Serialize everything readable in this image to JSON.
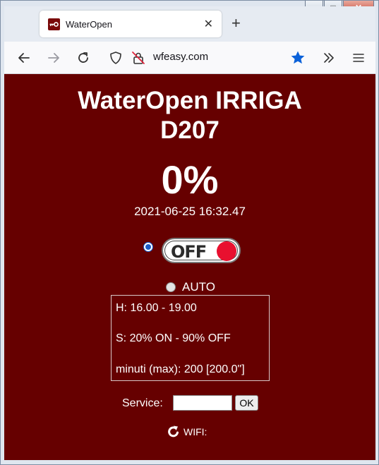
{
  "browser": {
    "tab_title": "WaterOpen",
    "url": "wfeasy.com",
    "window_controls": {
      "minimize": "–",
      "maximize": "□",
      "close": "✕"
    },
    "tab_close": "✕",
    "new_tab": "+"
  },
  "page": {
    "title_line1": "WaterOpen IRRIGA",
    "title_line2": "D207",
    "percent": "0%",
    "datetime": "2021-06-25 16:32.47",
    "toggle_label": "OFF",
    "manual_selected": true,
    "auto_label": "AUTO",
    "info": {
      "hours": "H: 16.00 - 19.00",
      "schedule": "S: 20% ON - 90% OFF",
      "minutes": "minuti (max): 200 [200.0\"]"
    },
    "service_label": "Service:",
    "service_value": "",
    "ok_label": "OK",
    "wifi_label": "WIFI:"
  },
  "colors": {
    "background": "#660000",
    "toggle_knob": "#e8102f",
    "bookmark_star": "#0a61d9"
  },
  "icons": {
    "back": "arrow-left-icon",
    "forward": "arrow-right-icon",
    "reload": "reload-icon",
    "shield": "shield-icon",
    "insecure": "insecure-lock-icon",
    "bookmark": "star-icon",
    "overflow": "chevron-double-right-icon",
    "menu": "hamburger-menu-icon",
    "wifi_refresh": "refresh-icon"
  }
}
